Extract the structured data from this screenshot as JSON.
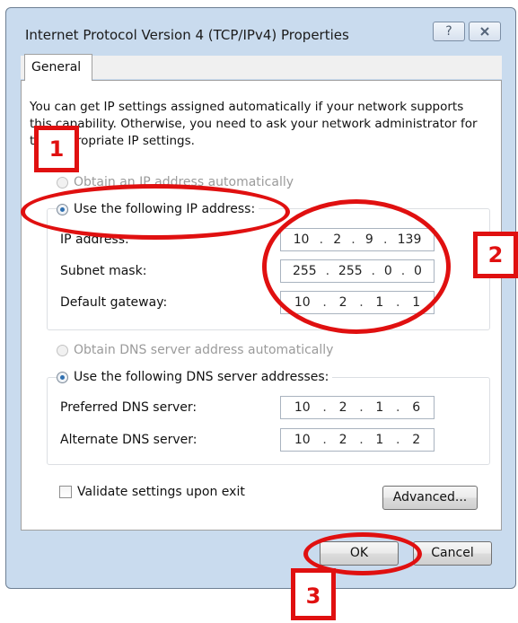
{
  "window": {
    "title": "Internet Protocol Version 4 (TCP/IPv4) Properties",
    "help_icon": "question-icon",
    "close_icon": "close-icon"
  },
  "tabs": [
    {
      "label": "General"
    }
  ],
  "description": "You can get IP settings assigned automatically if your network supports this capability. Otherwise, you need to ask your network administrator for the appropriate IP settings.",
  "ip": {
    "auto_label": "Obtain an IP address automatically",
    "manual_label": "Use the following IP address:",
    "selected": "manual",
    "fields": {
      "ip_address": {
        "label": "IP address:",
        "octets": [
          "10",
          "2",
          "9",
          "139"
        ]
      },
      "subnet_mask": {
        "label": "Subnet mask:",
        "octets": [
          "255",
          "255",
          "0",
          "0"
        ]
      },
      "default_gateway": {
        "label": "Default gateway:",
        "octets": [
          "10",
          "2",
          "1",
          "1"
        ]
      }
    }
  },
  "dns": {
    "auto_label": "Obtain DNS server address automatically",
    "manual_label": "Use the following DNS server addresses:",
    "selected": "manual",
    "fields": {
      "preferred": {
        "label": "Preferred DNS server:",
        "octets": [
          "10",
          "2",
          "1",
          "6"
        ]
      },
      "alternate": {
        "label": "Alternate DNS server:",
        "octets": [
          "10",
          "2",
          "1",
          "2"
        ]
      }
    }
  },
  "validate_label": "Validate settings upon exit",
  "validate_checked": false,
  "buttons": {
    "advanced": "Advanced...",
    "ok": "OK",
    "cancel": "Cancel"
  },
  "annotations": {
    "marker_1": "1",
    "marker_2": "2",
    "marker_3": "3",
    "color": "#e01010"
  }
}
